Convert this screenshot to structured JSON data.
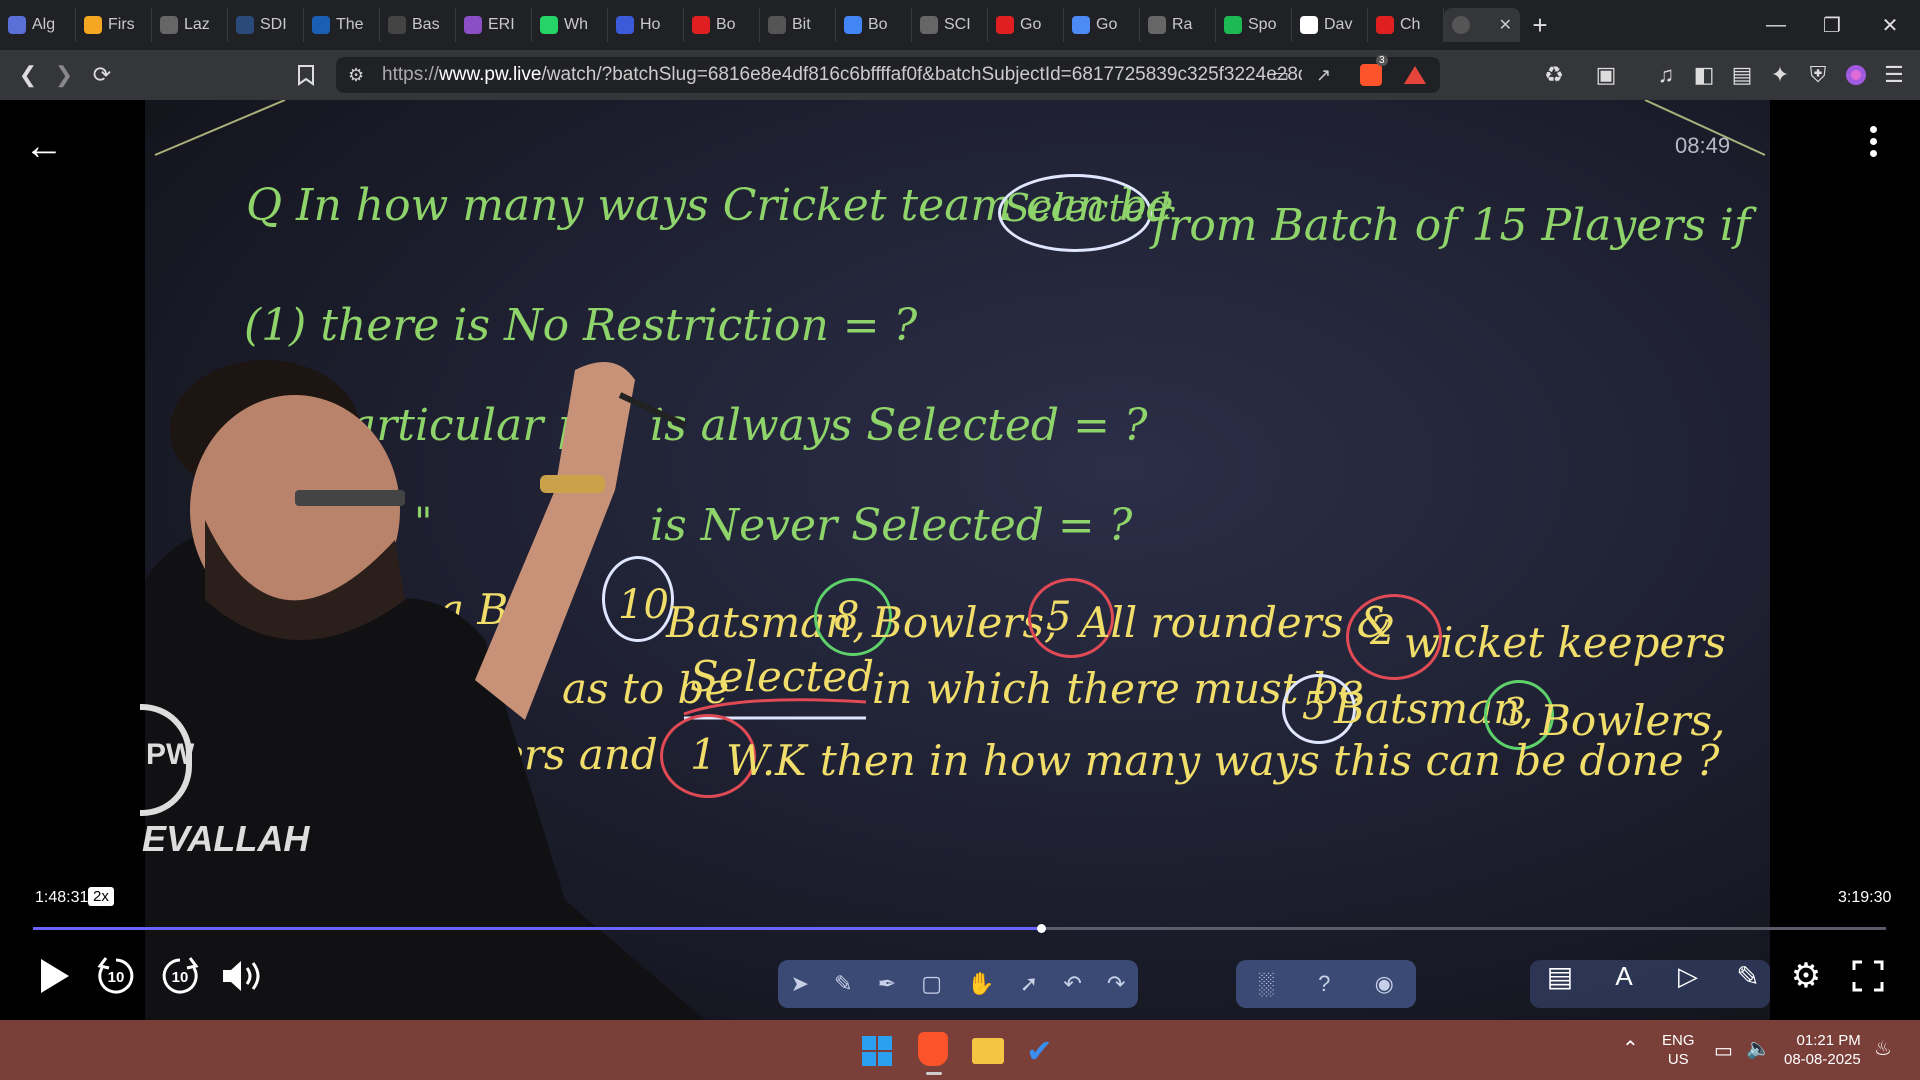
{
  "browser": {
    "tabs": [
      {
        "label": "Alg",
        "color": "#5b6fd8",
        "icon": "chatgpt-icon"
      },
      {
        "label": "Firs",
        "color": "#f5a623",
        "icon": "stack-icon"
      },
      {
        "label": "Laz",
        "color": "#666666",
        "icon": "globe-icon"
      },
      {
        "label": "SDI",
        "color": "#2a4a7a",
        "icon": "page-icon"
      },
      {
        "label": "The",
        "color": "#1a5fb4",
        "icon": "w3-icon"
      },
      {
        "label": "Bas",
        "color": "#444444",
        "icon": "page-icon"
      },
      {
        "label": "ERI",
        "color": "#8a4fc4",
        "icon": "page-icon"
      },
      {
        "label": "Wh",
        "color": "#25d366",
        "icon": "whatsapp-icon"
      },
      {
        "label": "Ho",
        "color": "#3b5bdb",
        "icon": "bookmark-icon"
      },
      {
        "label": "Bo",
        "color": "#e02020",
        "icon": "youtube-icon"
      },
      {
        "label": "Bit",
        "color": "#555555",
        "icon": "page-icon"
      },
      {
        "label": "Bo",
        "color": "#4285f4",
        "icon": "google-icon"
      },
      {
        "label": "SCI",
        "color": "#666666",
        "icon": "globe-icon"
      },
      {
        "label": "Go",
        "color": "#e02020",
        "icon": "youtube-icon"
      },
      {
        "label": "Go",
        "color": "#4c8bf5",
        "icon": "gemini-icon"
      },
      {
        "label": "Ra",
        "color": "#666666",
        "icon": "openai-icon"
      },
      {
        "label": "Spo",
        "color": "#1db954",
        "icon": "spotify-icon"
      },
      {
        "label": "Dav",
        "color": "#ffffff",
        "icon": "wikipedia-icon"
      },
      {
        "label": "Ch",
        "color": "#e02020",
        "icon": "youtube-icon"
      }
    ],
    "active_tab_close": "✕",
    "new_tab": "+",
    "url_prefix": "https://",
    "url_host": "www.pw.live",
    "url_path": "/watch/?batchSlug=6816e8e4df816c6bffffaf0f&batchSubjectId=6817725839c325f3224e28d...",
    "brave_badge": "3"
  },
  "player": {
    "timer": "08:49",
    "current_time": "1:48:31",
    "speed": "2x",
    "duration": "3:19:30",
    "progress_fraction": 0.5438,
    "skip_back_label": "10",
    "skip_forward_label": "10"
  },
  "board": {
    "line1": "Q  In how many ways  Cricket team can be",
    "selected_word": "Selected",
    "line1_tail": "from Batch of 15 Players if",
    "line2": "(1)  there is No Restriction = ?",
    "line3": "articular p",
    "line3_tail": "is always Selected = ?",
    "line4_mark": "\"",
    "line4": "is Never Selected = ?",
    "line5_start": "In a Ba",
    "n10": "10",
    "line5_a": "Batsman,",
    "n8": "8",
    "line5_b": "Bowlers,",
    "n5": "5",
    "line5_c": "All rounders &",
    "n2": "2",
    "line5_d": "wicket keepers",
    "line6_a": "as to be",
    "selected2": "Selected",
    "line6_b": "in which there must be",
    "n5b": "5",
    "line6_c": "Batsman,",
    "n3": "3",
    "line6_d": "Bowlers,",
    "line7_a": "unders and",
    "n1": "1",
    "line7_b": "W.K  then in how many ways this can be done ?",
    "logo_text": "EVALLAH",
    "logo_mark": "PW"
  },
  "taskbar": {
    "lang_top": "ENG",
    "lang_bottom": "US",
    "time": "01:21 PM",
    "date": "08-08-2025"
  }
}
